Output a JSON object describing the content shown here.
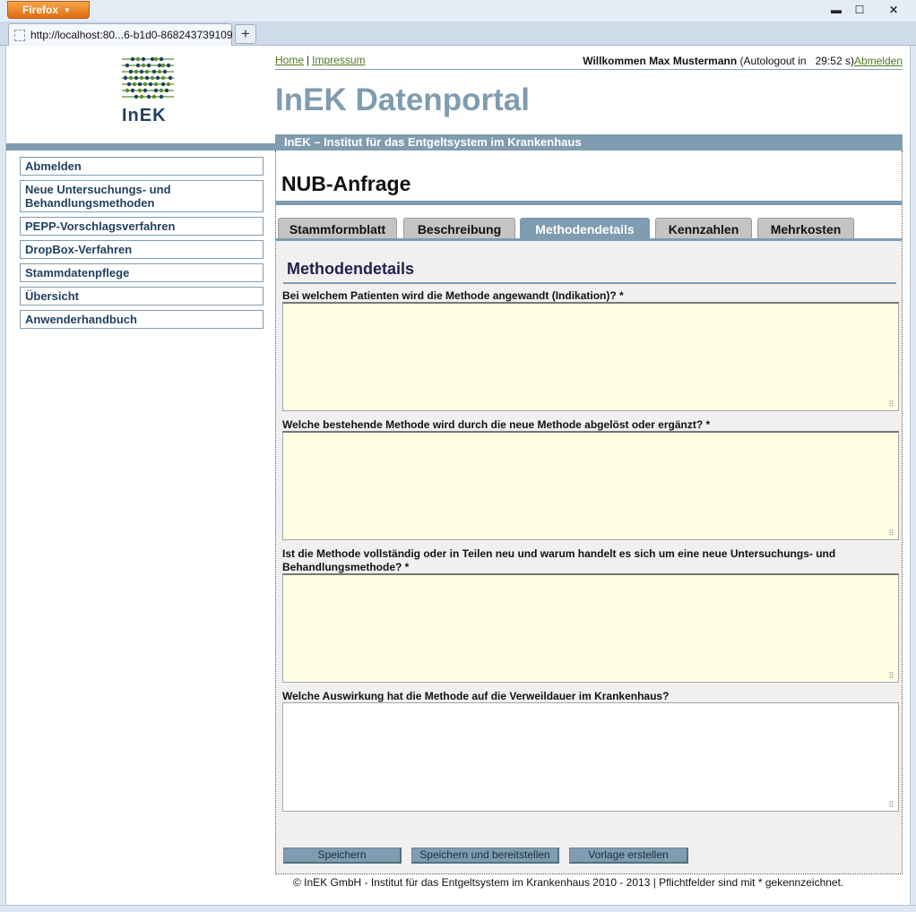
{
  "browser": {
    "app_button": "Firefox",
    "tab_title": "http://localhost:80...6-b1d0-868243739109",
    "new_tab": "+",
    "min": "▬",
    "max": "☐",
    "close": "✕"
  },
  "logo": {
    "text": "InEK"
  },
  "sidebar": {
    "items": [
      {
        "label": "Abmelden"
      },
      {
        "label": "Neue Untersuchungs- und Behandlungsmethoden"
      },
      {
        "label": "PEPP-Vorschlagsverfahren"
      },
      {
        "label": "DropBox-Verfahren"
      },
      {
        "label": "Stammdatenpflege"
      },
      {
        "label": "Übersicht"
      },
      {
        "label": "Anwenderhandbuch"
      }
    ]
  },
  "header": {
    "home": "Home",
    "separator": "|",
    "impressum": "Impressum",
    "welcome": "Willkommen Max Mustermann",
    "autologout": "(Autologout in",
    "timer": "29:52 s)",
    "logout": "Abmelden",
    "portal_title": "InEK Datenportal",
    "institute": "InEK – Institut für das Entgeltsystem im Krankenhaus"
  },
  "page": {
    "title": "NUB-Anfrage",
    "tabs": [
      {
        "label": "Stammformblatt"
      },
      {
        "label": "Beschreibung"
      },
      {
        "label": "Methodendetails"
      },
      {
        "label": "Kennzahlen"
      },
      {
        "label": "Mehrkosten"
      }
    ],
    "active_tab": "Methodendetails",
    "section_title": "Methodendetails",
    "questions": [
      {
        "label": "Bei welchem Patienten wird die Methode angewandt (Indikation)? *",
        "value": ""
      },
      {
        "label": "Welche bestehende Methode wird durch die neue Methode abgelöst oder ergänzt? *",
        "value": ""
      },
      {
        "label": "Ist die Methode vollständig oder in Teilen neu und warum handelt es sich um eine neue Untersuchungs- und Behandlungsmethode? *",
        "value": ""
      },
      {
        "label": "Welche Auswirkung hat die Methode auf die Verweildauer im Krankenhaus?",
        "value": ""
      }
    ],
    "buttons": {
      "save": "Speichern",
      "save_provide": "Speichern und bereitstellen",
      "template": "Vorlage erstellen"
    }
  },
  "footer": {
    "text": "© InEK GmbH - Institut für das Entgeltsystem im Krankenhaus 2010 - 2013 | Pflichtfelder sind mit * gekennzeichnet."
  },
  "colors": {
    "accent": "#7f9cb0",
    "link": "#4d7a1f",
    "required_field": "#ffffe4",
    "logo_green": "#5a8f2a",
    "logo_blue": "#1f4060"
  }
}
